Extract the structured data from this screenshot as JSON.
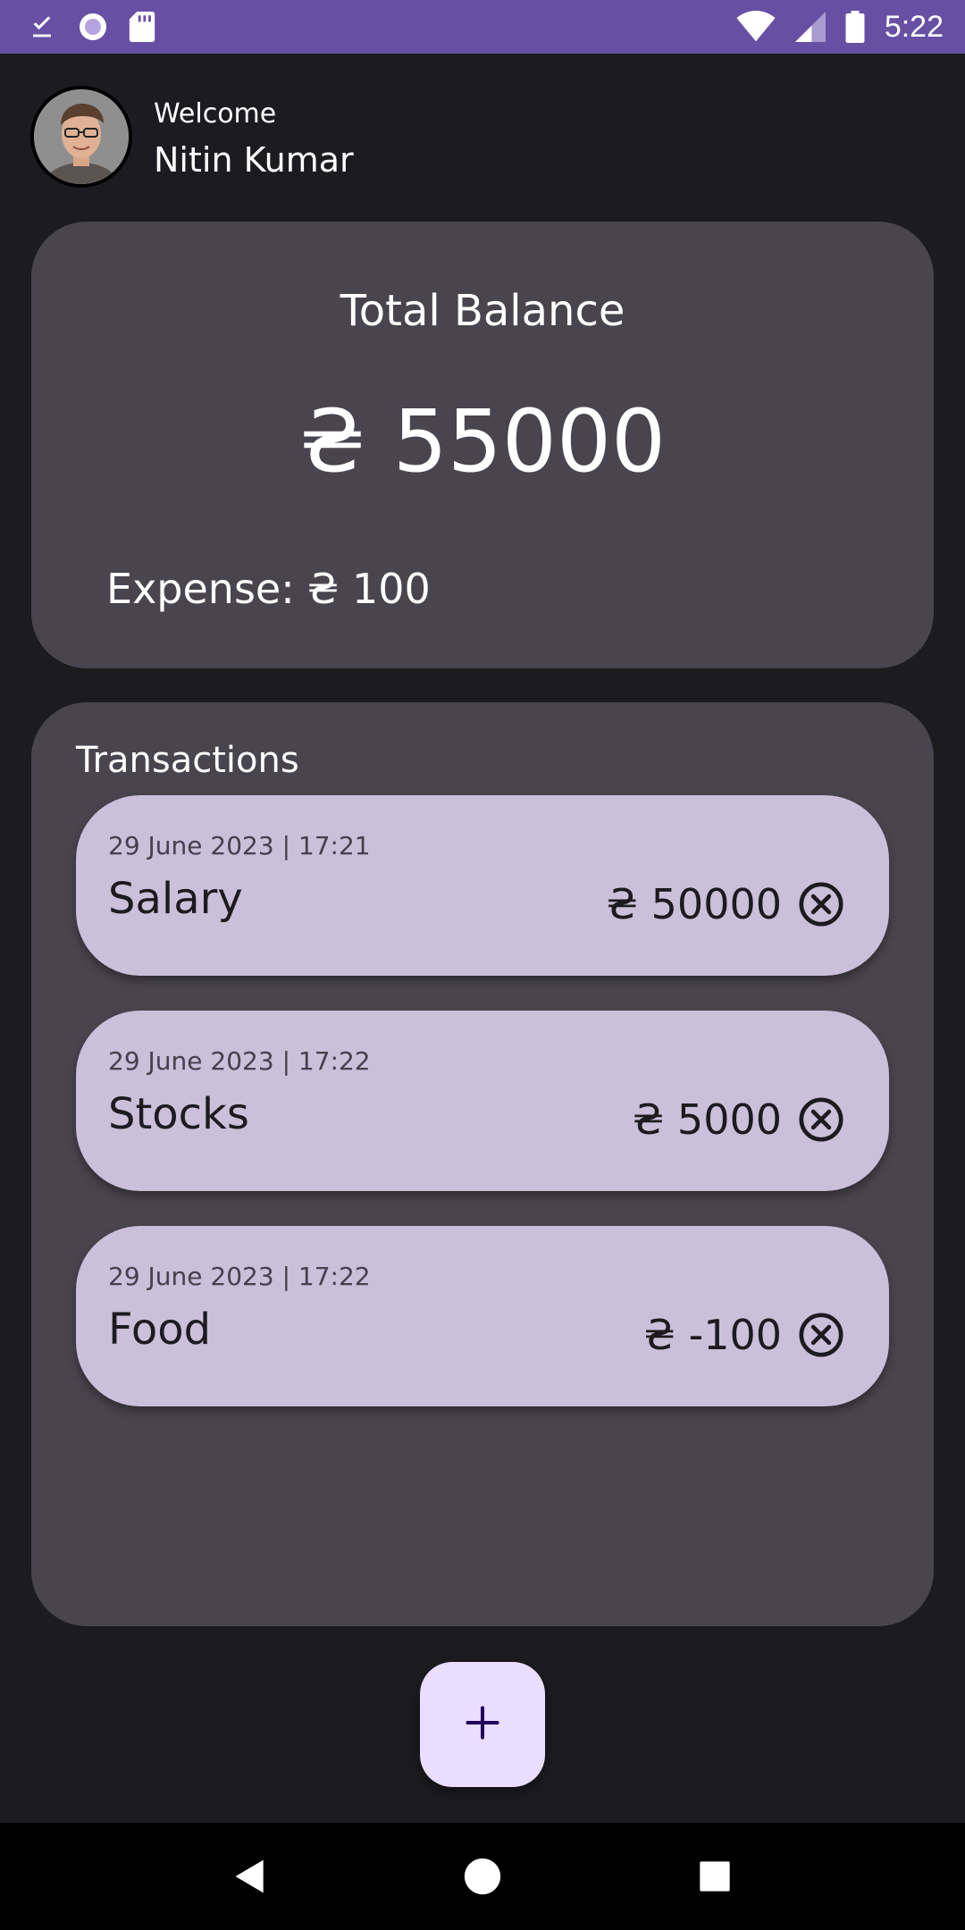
{
  "status_bar": {
    "time": "5:22",
    "icons_left": [
      "download-done-icon",
      "radio-icon",
      "sd-card-icon"
    ],
    "icons_right": [
      "wifi-icon",
      "cell-signal-icon",
      "battery-icon"
    ],
    "background": "#6750a4"
  },
  "header": {
    "welcome": "Welcome",
    "user_name": "Nitin Kumar"
  },
  "balance": {
    "title": "Total Balance",
    "amount": "₴ 55000",
    "expense_label": "Expense:",
    "expense_value": "₴ 100"
  },
  "transactions": {
    "title": "Transactions",
    "items": [
      {
        "date": "29 June 2023 | 17:21",
        "name": "Salary",
        "amount": "₴ 50000"
      },
      {
        "date": "29 June 2023 | 17:22",
        "name": "Stocks",
        "amount": "₴ 5000"
      },
      {
        "date": "29 June 2023 | 17:22",
        "name": "Food",
        "amount": "₴ -100"
      }
    ]
  },
  "fab": {
    "label": "+",
    "icon": "add-icon"
  },
  "colors": {
    "background": "#1c1b1f",
    "card": "#49454f",
    "transaction_card": "#cac0da",
    "fab": "#eaddff"
  }
}
